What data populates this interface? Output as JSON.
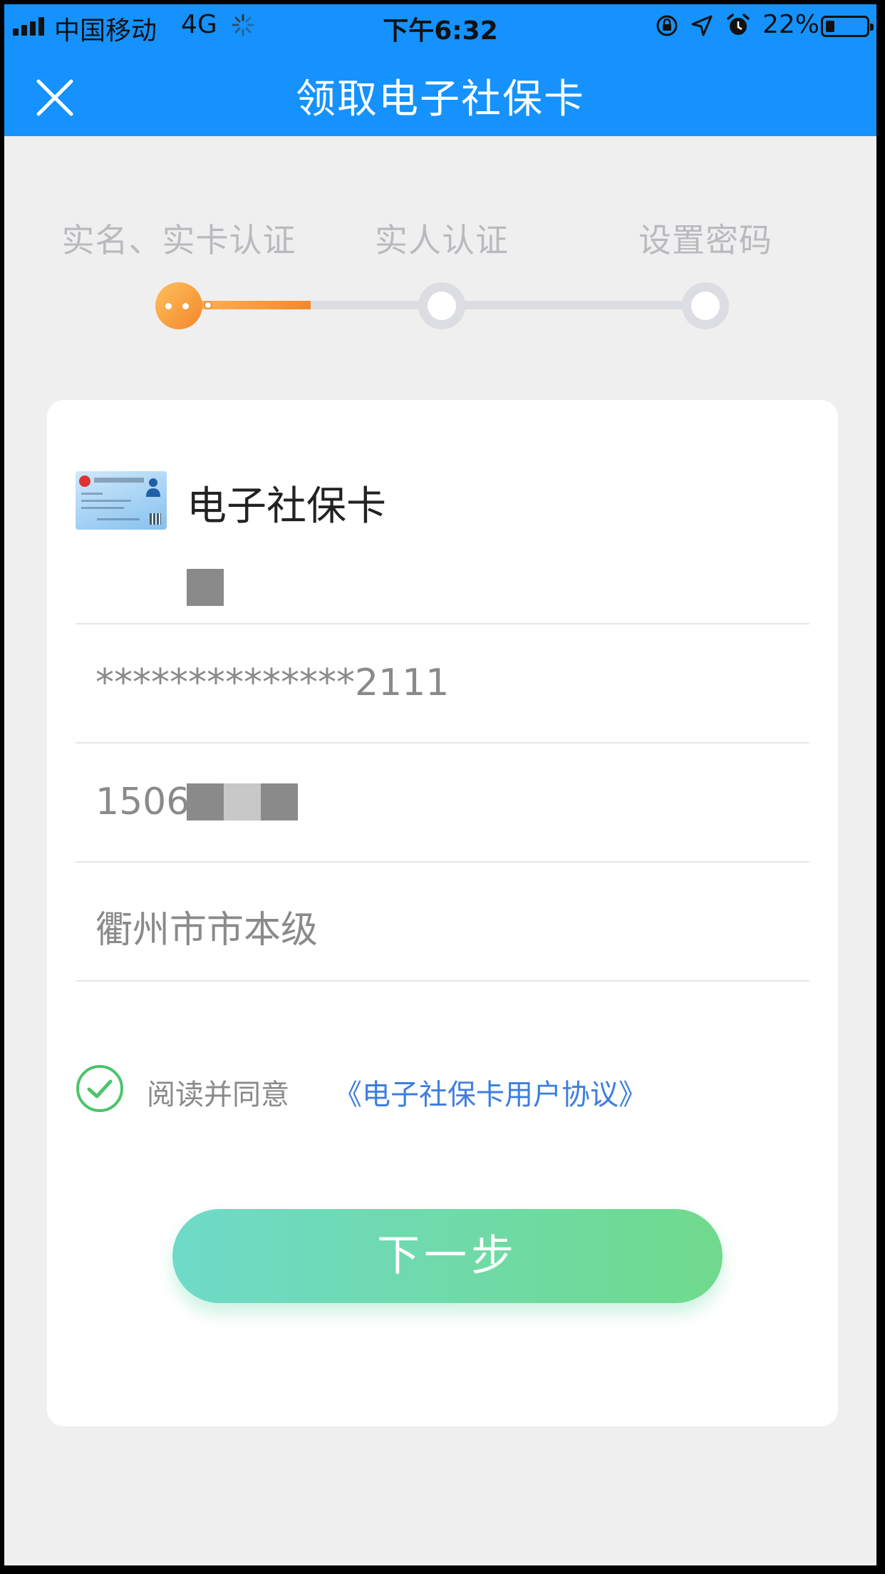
{
  "status_bar": {
    "carrier": "中国移动",
    "network": "4G",
    "time": "下午6:32",
    "battery": "22%"
  },
  "nav": {
    "title": "领取电子社保卡",
    "close_icon": "close-icon"
  },
  "steps": [
    {
      "label": "实名、实卡认证",
      "state": "active"
    },
    {
      "label": "实人认证",
      "state": "pending"
    },
    {
      "label": "设置密码",
      "state": "pending"
    }
  ],
  "card": {
    "title": "电子社保卡",
    "name_value": "",
    "id_value": "**************2111",
    "phone_value": "1506",
    "region_value": "衢州市市本级"
  },
  "agreement": {
    "checked": true,
    "text": "阅读并同意",
    "link": "《电子社保卡用户协议》"
  },
  "actions": {
    "next_label": "下一步"
  },
  "colors": {
    "header_blue": "#1592fd",
    "step_active": "#f4862b",
    "link_blue": "#3e7ee0",
    "button_green": "#6fda8c",
    "check_green": "#4cc46a"
  }
}
